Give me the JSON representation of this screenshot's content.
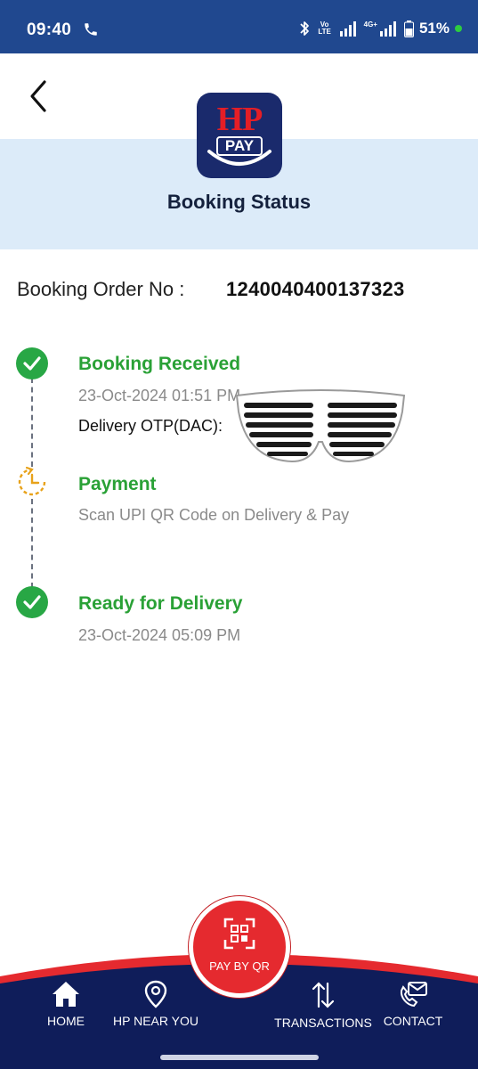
{
  "status_bar": {
    "time": "09:40",
    "volte": "Vo LTE",
    "network": "4G+",
    "battery": "51%",
    "icons": [
      "call-icon",
      "bluetooth-icon",
      "signal-icon",
      "battery-icon"
    ]
  },
  "header": {
    "logo_hp": "HP",
    "logo_pay": "PAY",
    "title": "Booking Status"
  },
  "order": {
    "label": "Booking Order No :",
    "number": "1240040400137323"
  },
  "timeline": {
    "steps": [
      {
        "title": "Booking Received",
        "subtitle": "23-Oct-2024 01:51 PM",
        "status": "done",
        "icon": "check-icon"
      },
      {
        "title": "Payment",
        "subtitle": "Scan UPI QR Code on Delivery & Pay",
        "status": "pending",
        "icon": "clock-icon"
      },
      {
        "title": "Ready for Delivery",
        "subtitle": "23-Oct-2024 05:09 PM",
        "status": "done",
        "icon": "check-icon"
      }
    ],
    "otp_label": "Delivery OTP(DAC):"
  },
  "bottom_nav": {
    "items": [
      {
        "label": "HOME",
        "icon": "home-icon"
      },
      {
        "label": "HP NEAR YOU",
        "icon": "location-pin-icon"
      },
      {
        "label": "TRANSACTIONS",
        "icon": "transfer-arrows-icon"
      },
      {
        "label": "CONTACT",
        "icon": "phone-mail-icon"
      }
    ],
    "center_button": {
      "label": "PAY BY QR",
      "icon": "qr-scan-icon"
    }
  },
  "colors": {
    "status_bar": "#20488f",
    "header_band": "#dcebf9",
    "title_text": "#14213d",
    "success_green": "#2aa136",
    "pending_orange": "#e8a21a",
    "nav_navy": "#0f1d5a",
    "nav_red": "#e52a2f"
  }
}
